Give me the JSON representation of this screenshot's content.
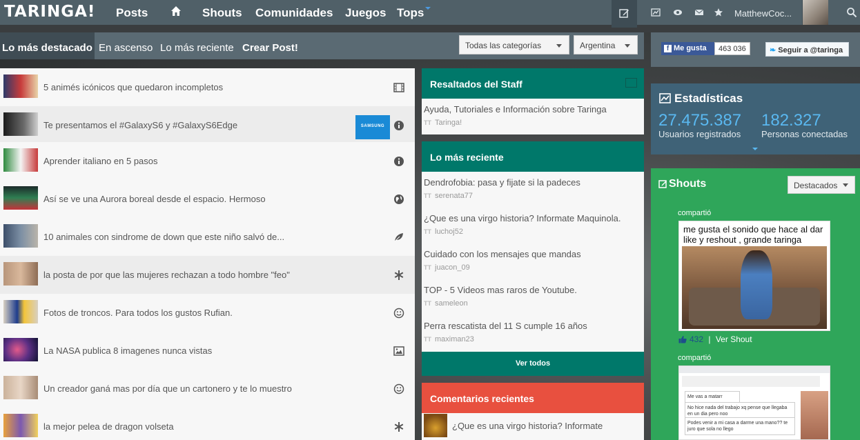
{
  "nav": {
    "logo": "TARINGA!",
    "links": [
      "Posts",
      "Shouts",
      "Comunidades",
      "Juegos",
      "Tops"
    ],
    "username": "MatthewCoc..."
  },
  "subnav": {
    "tabs": [
      "Lo más destacado",
      "En ascenso",
      "Lo más reciente",
      "Crear Post!"
    ],
    "category_select": "Todas las categorías",
    "country_select": "Argentina"
  },
  "social": {
    "fb_label": "Me gusta",
    "fb_count": "463 036",
    "twitter_label": "Seguir a @taringa"
  },
  "posts": [
    {
      "title": "5 animés icónicos que quedaron incompletos",
      "icon": "film-icon"
    },
    {
      "title": "Te presentamos el #GalaxyS6 y #GalaxyS6Edge",
      "icon": "info-icon",
      "sponsor": "SAMSUNG"
    },
    {
      "title": "Aprender italiano en 5 pasos",
      "icon": "info-icon"
    },
    {
      "title": "Así se ve una Aurora boreal desde el espacio. Hermoso",
      "icon": "globe-icon"
    },
    {
      "title": "10 animales con sindrome de down que este niño salvó de...",
      "icon": "leaf-icon"
    },
    {
      "title": "la posta de por que las mujeres rechazan a todo hombre \"feo\"",
      "icon": "asterisk-icon"
    },
    {
      "title": "Fotos de troncos. Para todos los gustos Rufian.",
      "icon": "smiley-icon"
    },
    {
      "title": "La NASA publica 8 imagenes nunca vistas",
      "icon": "image-icon"
    },
    {
      "title": "Un creador ganá mas por día que un cartonero y te lo muestro",
      "icon": "smiley-icon"
    },
    {
      "title": "la mejor pelea de dragon volseta",
      "icon": "asterisk-icon"
    }
  ],
  "staff": {
    "heading": "Resaltados del Staff",
    "item_title": "Ayuda, Tutoriales e Información sobre Taringa",
    "item_user": "Taringa!"
  },
  "recent": {
    "heading": "Lo más reciente",
    "items": [
      {
        "title": "Dendrofobia: pasa y fijate si la padeces",
        "user": "serenata77"
      },
      {
        "title": "¿Que es una virgo historia? Informate Maquinola.",
        "user": "luchoj52"
      },
      {
        "title": "Cuidado con los mensajes que mandas",
        "user": "juacon_09"
      },
      {
        "title": "TOP - 5 Videos mas raros de Youtube.",
        "user": "sameleon"
      },
      {
        "title": "Perra rescatista del 11 S cumple 16 años",
        "user": "maximan23"
      }
    ],
    "ver_todos": "Ver todos"
  },
  "comments": {
    "heading": "Comentarios recientes",
    "item_title": "¿Que es una virgo historia? Informate"
  },
  "stats": {
    "heading": "Estadísticas",
    "registered_count": "27.475.387",
    "registered_label": "Usuarios registrados",
    "online_count": "182.327",
    "online_label": "Personas conectadas"
  },
  "shouts": {
    "heading": "Shouts",
    "filter": "Destacados",
    "shared_label": "compartió",
    "meme_text": "me gusta el sonido que hace al dar like y reshout , grande taringa",
    "likes": "432",
    "ver_shout": "Ver Shout",
    "chat_1": "Me vas a matarr",
    "chat_2": "No hice nada del trabajo xq pense que llegaba en un dia pero noo",
    "chat_3": "Podes venir a mi casa a darme una mano?? te juro que sola no llego"
  },
  "colors": {
    "nav_bg": "#506068",
    "teal": "#00786a",
    "red": "#e8503f",
    "green": "#2fa65a",
    "stats_bg": "#3f6277",
    "stat_num": "#5ab8f0"
  }
}
